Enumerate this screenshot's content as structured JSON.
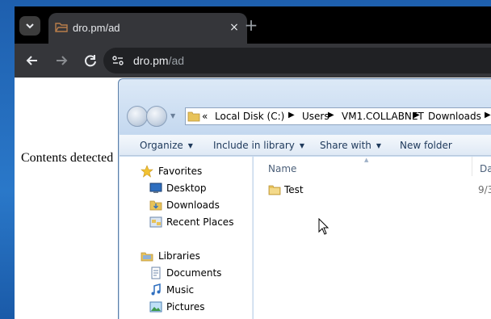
{
  "browser": {
    "tab_title": "dro.pm/ad",
    "tab_close": "×",
    "new_tab": "+",
    "url_host": "dro.pm",
    "url_path": "/ad"
  },
  "page": {
    "text": "Contents detected"
  },
  "explorer": {
    "breadcrumb": {
      "overflow": "«",
      "items": [
        "Local Disk (C:)",
        "Users",
        "VM1.COLLABNET",
        "Downloads"
      ]
    },
    "commands": {
      "organize": "Organize",
      "include_in_library": "Include in library",
      "share_with": "Share with",
      "new_folder": "New folder"
    },
    "nav": {
      "favorites": "Favorites",
      "desktop": "Desktop",
      "downloads": "Downloads",
      "recent_places": "Recent Places",
      "libraries": "Libraries",
      "documents": "Documents",
      "music": "Music",
      "pictures": "Pictures"
    },
    "columns": {
      "name": "Name",
      "date": "Dat"
    },
    "files": [
      {
        "name": "Test",
        "date": "9/3"
      }
    ]
  },
  "colors": {
    "chrome_dark": "#35363a",
    "tab_strip": "#000000",
    "explorer_frame": "#c7daf0",
    "folder_yellow": "#e8c35a"
  }
}
